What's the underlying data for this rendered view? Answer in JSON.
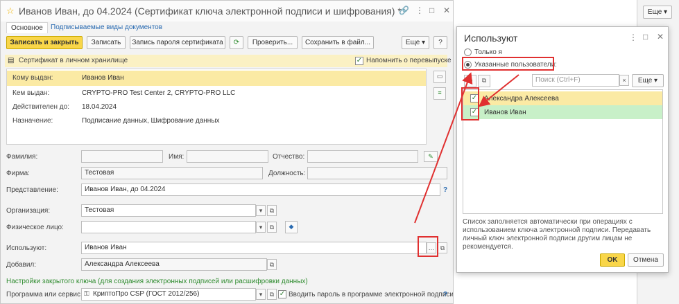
{
  "main": {
    "title": "Иванов Иван, до 04.2024 (Сертификат ключа электронной подписи и шифрования) *",
    "tabs": [
      "Основное",
      "Подписываемые виды документов"
    ],
    "toolbar": {
      "save_close": "Записать и закрыть",
      "save": "Записать",
      "save_password": "Запись пароля сертификата",
      "check": "Проверить...",
      "save_file": "Сохранить в файл...",
      "more": "Еще",
      "help": "?"
    },
    "info": {
      "storage": "Сертификат в личном хранилище",
      "remind": "Напомнить о перевыпуске"
    },
    "cert": {
      "issued_to_label": "Кому выдан:",
      "issued_to": "Иванов Иван",
      "issued_by_label": "Кем выдан:",
      "issued_by": "CRYPTO-PRO Test Center 2, CRYPTO-PRO LLC",
      "valid_label": "Действителен до:",
      "valid": "18.04.2024",
      "purpose_label": "Назначение:",
      "purpose": "Подписание данных, Шифрование данных"
    },
    "form": {
      "surname_label": "Фамилия:",
      "name_label": "Имя:",
      "patronymic_label": "Отчество:",
      "firm_label": "Фирма:",
      "firm": "Тестовая",
      "position_label": "Должность:",
      "repr_label": "Представление:",
      "repr": "Иванов Иван, до 04.2024",
      "org_label": "Организация:",
      "org": "Тестовая",
      "person_label": "Физическое лицо:",
      "users_label": "Используют:",
      "users": "Иванов Иван",
      "added_label": "Добавил:",
      "added": "Александра Алексеева",
      "private_key_link": "Настройки закрытого ключа (для создания электронных подписей или расшифровки данных)",
      "program_label": "Программа или сервис:",
      "program": "КриптоПро CSP (ГОСТ 2012/256)",
      "enter_password": "Вводить пароль в программе электронной подписи"
    }
  },
  "popup": {
    "title": "Используют",
    "radio_only_me": "Только я",
    "radio_users": "Указанные пользователи:",
    "search_placeholder": "Поиск (Ctrl+F)",
    "more": "Еще",
    "users": [
      {
        "name": "Александра Алексеева",
        "checked": true
      },
      {
        "name": "Иванов Иван",
        "checked": true
      }
    ],
    "note": "Список заполняется автоматически при операциях с использованием ключа электронной подписи. Передавать личный ключ электронной подписи другим лицам не рекомендуется.",
    "ok": "OK",
    "cancel": "Отмена"
  },
  "background": {
    "more": "Еще"
  },
  "colors": {
    "accent_yellow": "#f9d649",
    "highlight_red": "#e03030",
    "selection_green": "#c8f0c8",
    "selection_yellow": "#fbeaa4",
    "link_blue": "#2a6bb1"
  }
}
